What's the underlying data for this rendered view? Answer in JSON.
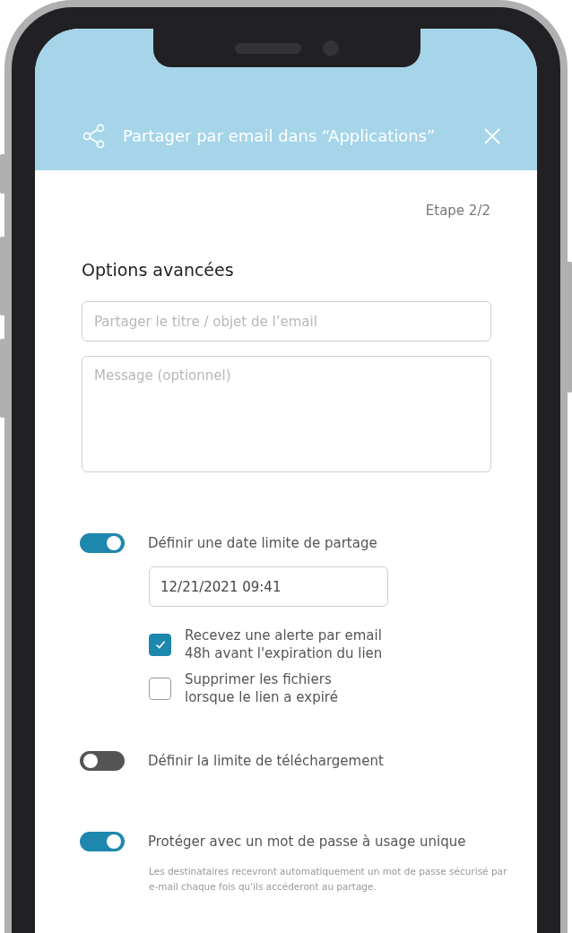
{
  "header": {
    "title": "Partager par email dans “Applications”"
  },
  "step": "Etape 2/2",
  "section_title": "Options avancées",
  "fields": [
    {
      "kind": "line",
      "placeholder": "Partager le titre / objet de l’email"
    },
    {
      "kind": "area",
      "placeholder": "Message (optionnel)"
    }
  ],
  "options": [
    {
      "label": "Définir une date limite de partage",
      "on": true,
      "date": "12/21/2021 09:41",
      "checkboxes": [
        {
          "label": "Recevez une alerte par email 48h avant l'expiration du lien",
          "checked": true
        },
        {
          "label": "Supprimer les fichiers lorsque le lien a expiré",
          "checked": false
        }
      ]
    },
    {
      "label": "Définir la limite de téléchargement",
      "on": false
    },
    {
      "label": "Protéger avec un mot de passe à usage unique",
      "on": true,
      "note": "Les destinataires recevront automatiquement un mot de passe sécurisé par e-mail chaque fois qu'ils accéderont au partage."
    }
  ]
}
